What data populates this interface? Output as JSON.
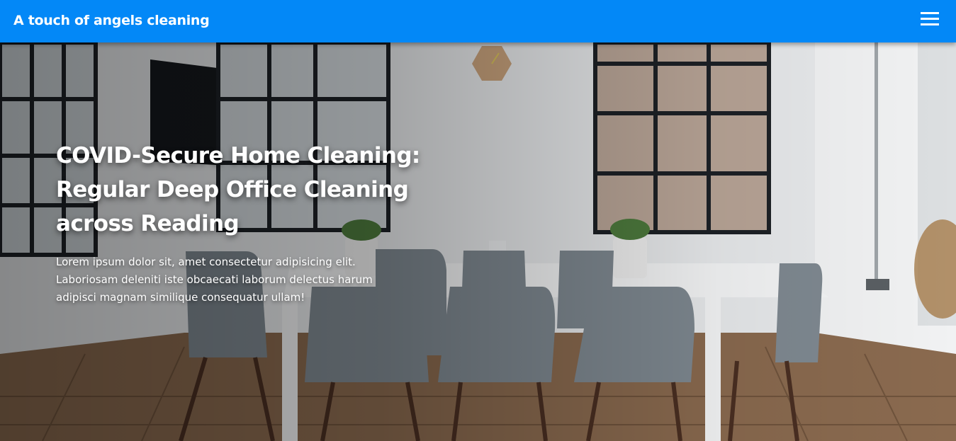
{
  "header": {
    "brand": "A touch of angels cleaning",
    "menu_icon": "hamburger-menu-icon",
    "background_color": "#0388f7"
  },
  "hero": {
    "title": "COVID-Secure Home Cleaning: Regular Deep Office Cleaning across Reading",
    "body": "Lorem ipsum dolor sit, amet consectetur adipisicing elit. Laboriosam deleniti iste obcaecati laborum delectus harum adipisci magnam similique consequatur ullam!"
  }
}
